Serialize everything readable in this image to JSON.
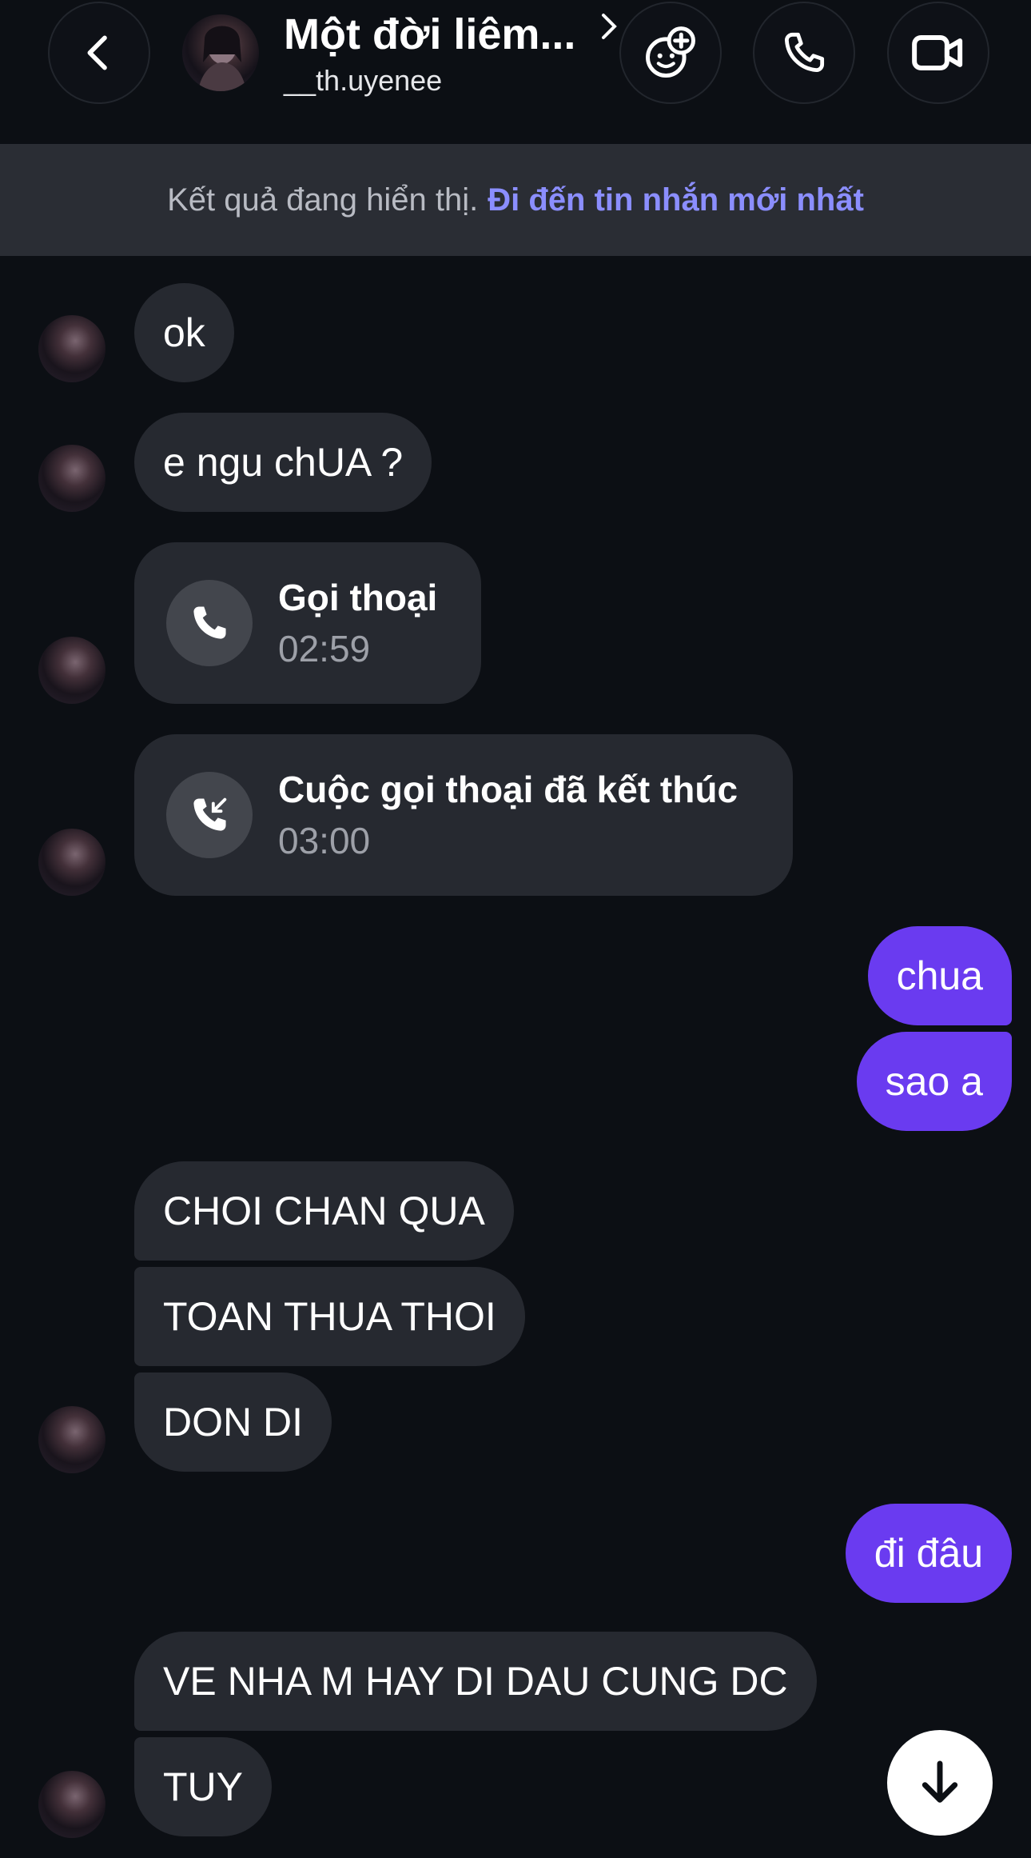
{
  "header": {
    "title": "Một đời liêm...",
    "username": "__th.uyenee"
  },
  "banner": {
    "text": "Kết quả đang hiển thị.",
    "link": "Đi đến tin nhắn mới nhất"
  },
  "messages": [
    {
      "side": "in",
      "text": "ok"
    },
    {
      "side": "in",
      "text": "e ngu chUA ?"
    },
    {
      "side": "in",
      "type": "call",
      "title": "Gọi thoại",
      "duration": "02:59"
    },
    {
      "side": "in",
      "type": "call",
      "title": "Cuộc gọi thoại đã kết thúc",
      "duration": "03:00"
    },
    {
      "side": "out",
      "text": "chua"
    },
    {
      "side": "out",
      "text": "sao a"
    },
    {
      "side": "in",
      "text": "CHOI CHAN QUA"
    },
    {
      "side": "in",
      "text": "TOAN THUA THOI"
    },
    {
      "side": "in",
      "text": "DON DI"
    },
    {
      "side": "out",
      "text": "đi đâu"
    },
    {
      "side": "in",
      "text": "VE NHA M HAY DI DAU CUNG DC"
    },
    {
      "side": "in",
      "text": "TUY"
    }
  ],
  "colors": {
    "background": "#0c0f14",
    "incoming_bubble": "#262930",
    "outgoing_bubble": "#6a3bf0",
    "link": "#8b8eff"
  }
}
